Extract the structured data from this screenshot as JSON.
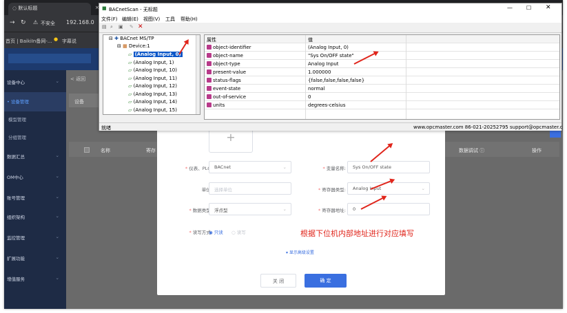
{
  "browser": {
    "tab_title": "默认标题",
    "tab_close": "×",
    "security_label": "不安全",
    "url": "192.168.0",
    "bookmarks": [
      "首页 | BaikiIn备网-...",
      "字幕说"
    ]
  },
  "sidebar": {
    "items": [
      {
        "label": "设备中心",
        "active": false
      },
      {
        "label": "• 设备管理",
        "active": true
      },
      {
        "label": "模型管理",
        "active": false
      },
      {
        "label": "分组管理",
        "active": false
      },
      {
        "label": "数据汇总",
        "active": false
      },
      {
        "label": "OM中心",
        "active": false
      },
      {
        "label": "账号管理",
        "active": false
      },
      {
        "label": "组织架构",
        "active": false
      },
      {
        "label": "监控管理",
        "active": false
      },
      {
        "label": "扩展功能",
        "active": false
      },
      {
        "label": "增值服务",
        "active": false
      }
    ]
  },
  "content": {
    "back": "< 返回",
    "table_headers": {
      "name": "名称",
      "register": "寄存",
      "debug": "数据调试 ⓘ",
      "action": "操作"
    },
    "add_label": "设备"
  },
  "bacnet": {
    "title": "BACnetScan - 无标题",
    "menu": [
      "文件(F)",
      "编辑(E)",
      "视图(V)",
      "工具",
      "帮助(H)"
    ],
    "tree": {
      "root": "BACnet MS/TP",
      "device": "Device:1",
      "items": [
        "(Analog Input, 0)",
        "(Analog Input, 1)",
        "(Analog Input, 10)",
        "(Analog Input, 11)",
        "(Analog Input, 12)",
        "(Analog Input, 13)",
        "(Analog Input, 14)",
        "(Analog Input, 15)"
      ],
      "selected_index": 0
    },
    "grid_headers": {
      "property": "属性",
      "value": "值"
    },
    "properties": [
      {
        "name": "object-identifier",
        "value": "(Analog Input, 0)"
      },
      {
        "name": "object-name",
        "value": "\"Sys On/OFF state\""
      },
      {
        "name": "object-type",
        "value": "Analog Input"
      },
      {
        "name": "present-value",
        "value": "1.000000"
      },
      {
        "name": "status-flags",
        "value": "{false,false,false,false}"
      },
      {
        "name": "event-state",
        "value": "normal"
      },
      {
        "name": "out-of-service",
        "value": "0"
      },
      {
        "name": "units",
        "value": "degrees-celsius"
      }
    ],
    "status_left": "就绪",
    "status_right": "www.opcmaster.com 86-021-20252795 support@opcmaster.com"
  },
  "dialog": {
    "plus": "+",
    "instrument_label": "仪表、PLC:",
    "instrument_value": "BACnet",
    "unit_label": "单位:",
    "unit_placeholder": "选择单位",
    "datatype_label": "数据类型:",
    "datatype_value": "浮点型",
    "rw_label": "读写方式:",
    "rw_options": [
      "只读",
      "读写"
    ],
    "varname_label": "变量名称:",
    "varname_value": "Sys On/OFF state",
    "regtype_label": "寄存器类型:",
    "regtype_value": "Analog Input",
    "regaddr_label": "寄存器地址:",
    "regaddr_value": "0",
    "annotation": "根据下位机内部地址进行对应填写",
    "advanced": "▾ 显示高级设置",
    "cancel": "关 闭",
    "confirm": "确 定"
  },
  "colors": {
    "accent": "#3a6fe0",
    "annotation": "#e0251b",
    "sidebar": "#1e2b45"
  }
}
